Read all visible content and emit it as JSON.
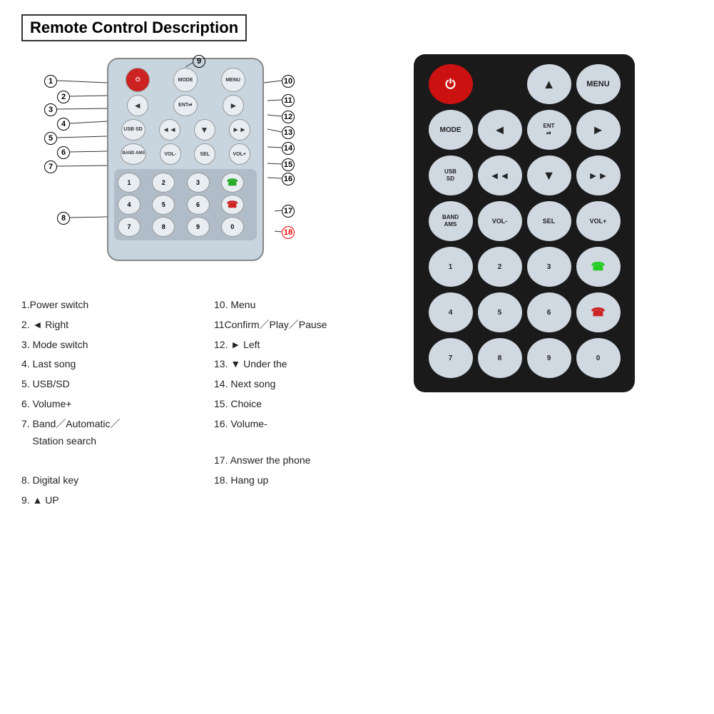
{
  "title": "Remote Control Description",
  "diagram": {
    "buttons": {
      "power": "⏻",
      "mode": "MODE",
      "usb_sd": "USB\nSD",
      "band": "BAND\nAMS",
      "menu": "MENU",
      "ent": "ENT\n⏯",
      "left_arrow": "◄",
      "right_arrow": "►",
      "prev": "◄◄",
      "next": "►►",
      "down_arrow": "▼",
      "vol_minus": "VOL-",
      "sel": "SEL",
      "vol_plus": "VOL+",
      "answer": "📞",
      "hangup": "📵"
    },
    "numeric": [
      "1",
      "2",
      "3",
      "",
      "4",
      "5",
      "6",
      "",
      "7",
      "8",
      "9",
      "0"
    ]
  },
  "callouts": [
    {
      "num": "1",
      "label": "Power switch"
    },
    {
      "num": "2",
      "label": "◄ Right"
    },
    {
      "num": "3",
      "label": "Mode switch"
    },
    {
      "num": "4",
      "label": "Last song"
    },
    {
      "num": "5",
      "label": "USB/SD"
    },
    {
      "num": "6",
      "label": "Volume+"
    },
    {
      "num": "7",
      "label": "Band／Automatic／\nStation search"
    },
    {
      "num": "8",
      "label": "Digital key"
    },
    {
      "num": "9",
      "label": "▲ UP"
    },
    {
      "num": "10",
      "label": "Menu"
    },
    {
      "num": "11",
      "label": "Confirm／Play／Pause"
    },
    {
      "num": "12",
      "label": "► Left"
    },
    {
      "num": "13",
      "label": "▼ Under the"
    },
    {
      "num": "14",
      "label": "Next song"
    },
    {
      "num": "15",
      "label": "Choice"
    },
    {
      "num": "16",
      "label": "Volume-"
    },
    {
      "num": "17",
      "label": "Answer the phone"
    },
    {
      "num": "18",
      "label": "Hang up"
    }
  ],
  "remote": {
    "rows": [
      [
        "⏻",
        "",
        "▲",
        "MENU"
      ],
      [
        "MODE",
        "◄",
        "ENT\n⏯",
        "►"
      ],
      [
        "USB\nSD",
        "◄◄",
        "▼",
        "►►"
      ],
      [
        "BAND\nAMS",
        "VOL-",
        "SEL",
        "VOL+"
      ],
      [
        "1",
        "2",
        "3",
        "☎"
      ],
      [
        "4",
        "5",
        "6",
        "☎"
      ],
      [
        "7",
        "8",
        "9",
        "0"
      ]
    ]
  }
}
